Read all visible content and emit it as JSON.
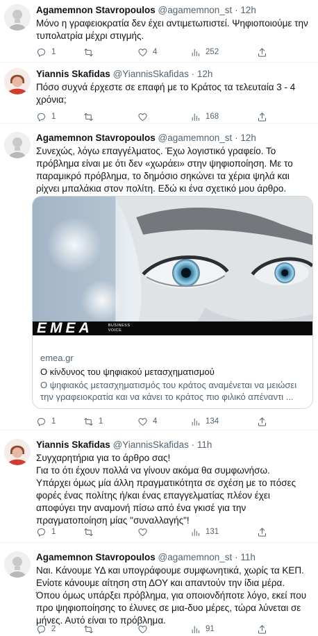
{
  "tweets": [
    {
      "name": "Agamemnon Stavropoulos",
      "handle": "@agamemnon_st",
      "time": "12h",
      "text": "Μόνο η γραφειοκρατία δεν έχει αντιμετωπιστεί. Ψηφιοποιούμε την τυπολατρία μέχρι στιγμής.",
      "replies": "1",
      "retweets": "",
      "likes": "4",
      "views": "252"
    },
    {
      "name": "Yiannis Skafidas",
      "handle": "@YiannisSkafidas",
      "time": "12h",
      "text": "Πόσο συχνά έρχεστε σε επαφή με το Κράτος τα τελευταία 3 - 4 χρόνια;",
      "replies": "1",
      "retweets": "",
      "likes": "",
      "views": "168"
    },
    {
      "name": "Agamemnon Stavropoulos",
      "handle": "@agamemnon_st",
      "time": "12h",
      "text": "Συνεχώς, λόγω επαγγέλματος. Έχω λογιστικό γραφείο. Το πρόβλημα είναι με ότι δεν «χωράει» στην ψηφιοποίηση. Με το παραμικρό πρόβλημα, το δημόσιο σηκώνει τα χέρια ψηλά και ρίχνει μπαλάκια στον πολίτη. Εδώ κι ένα σχετικό μου άρθρο.",
      "replies": "1",
      "retweets": "1",
      "likes": "4",
      "views": "134",
      "card": {
        "logo": "EMEA",
        "tagline_1": "BUSINESS",
        "tagline_2": "VOICE",
        "domain": "emea.gr",
        "title": "Ο κίνδυνος του ψηφιακού μετασχηματισμού",
        "description": "Ο ψηφιακός μετασχηματισμός του κράτος αναμένεται να μειώσει την γραφειοκρατία και να κάνει το κράτος πιο φιλικό απέναντι ..."
      }
    },
    {
      "name": "Yiannis Skafidas",
      "handle": "@YiannisSkafidas",
      "time": "11h",
      "text": "Συγχαρητήρια για το άρθρο σας!\nΓια το ότι έχουν πολλά να γίνουν ακόμα θα συμφωνήσω.\nΥπάρχει όμως μία άλλη πραγματικότητα σε σχέση με το πόσες φορές ένας πολίτης ή/και ένας επαγγελματίας πλέον έχει αποφύγει την αναμονή πίσω από ένα γκισέ για την πραγματοποίηση μίας \"συναλλαγής\"!",
      "replies": "1",
      "retweets": "",
      "likes": "",
      "views": "131"
    },
    {
      "name": "Agamemnon Stavropoulos",
      "handle": "@agamemnon_st",
      "time": "11h",
      "text": "Ναι. Κάνουμε ΥΔ και υπογράφουμε συμφωνητικά, χωρίς τα ΚΕΠ. Ενίοτε κάνουμε αίτηση στη ΔΟΥ και απαντούν την ίδια μέρα. Όπου όμως υπάρξει πρόβλημα, για οποιονδήποτε λόγο, εκεί που προ ψηφιοποίησης το έλυνες σε μια-δυο μέρες, τώρα λύνεται σε μήνες. Αυτό είναι το πρόβλημα.",
      "replies": "2",
      "retweets": "",
      "likes": "",
      "views": "91"
    }
  ],
  "separator": "·",
  "colors": {
    "text": "#0f1419",
    "secondary": "#536471",
    "border": "#cfd9de",
    "divider": "#eff3f4"
  }
}
